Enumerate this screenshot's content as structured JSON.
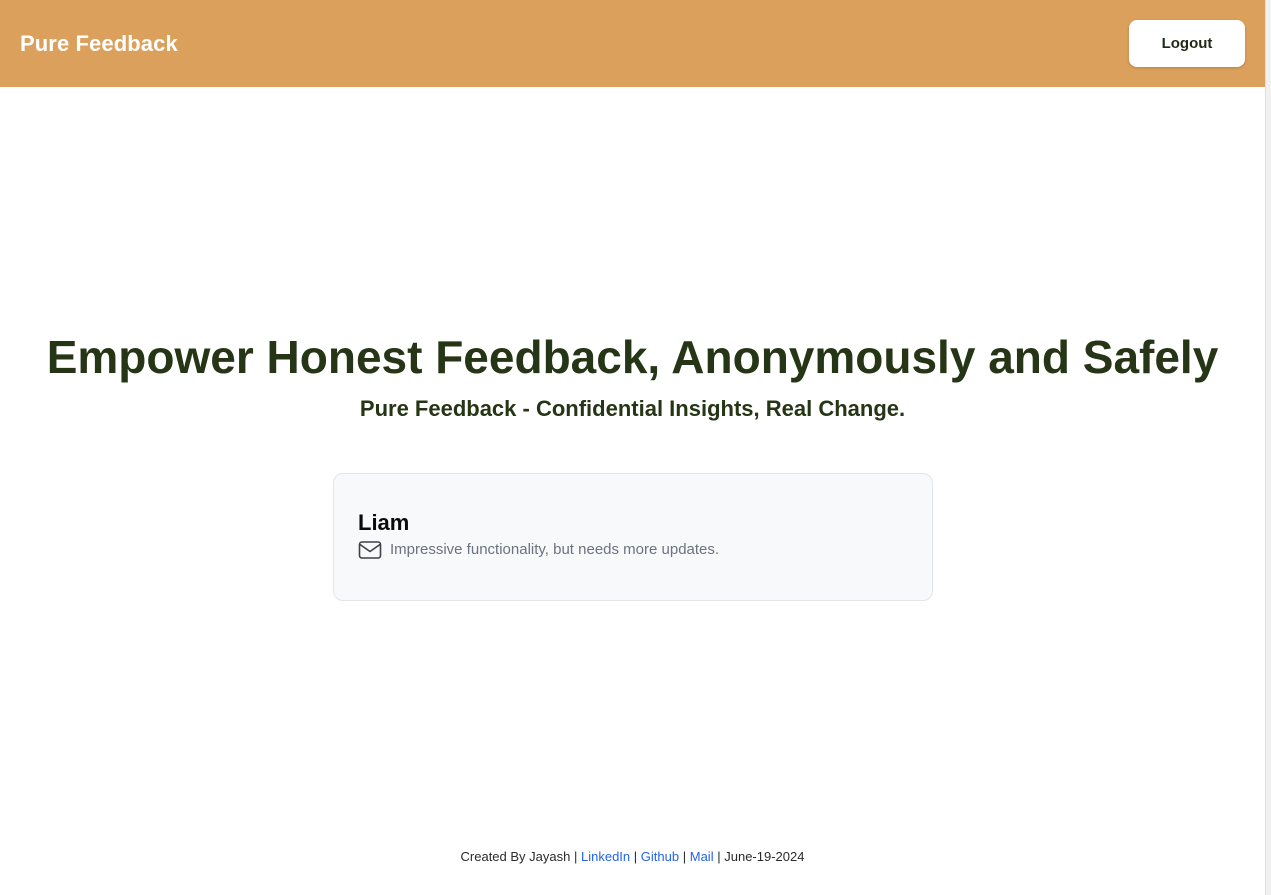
{
  "navbar": {
    "brand": "Pure Feedback",
    "logout_label": "Logout",
    "background": "#dba15c"
  },
  "hero": {
    "title": "Empower Honest Feedback, Anonymously and Safely",
    "subtitle": "Pure Feedback - Confidential Insights, Real Change."
  },
  "card": {
    "name": "Liam",
    "icon": "mail-icon",
    "message": "Impressive functionality, but needs more updates."
  },
  "footer": {
    "created_by": "Created By Jayash",
    "sep": "|",
    "linkedin_label": "LinkedIn",
    "github_label": "Github",
    "mail_label": "Mail",
    "date": "June-19-2024",
    "link_color": "#2563eb"
  }
}
